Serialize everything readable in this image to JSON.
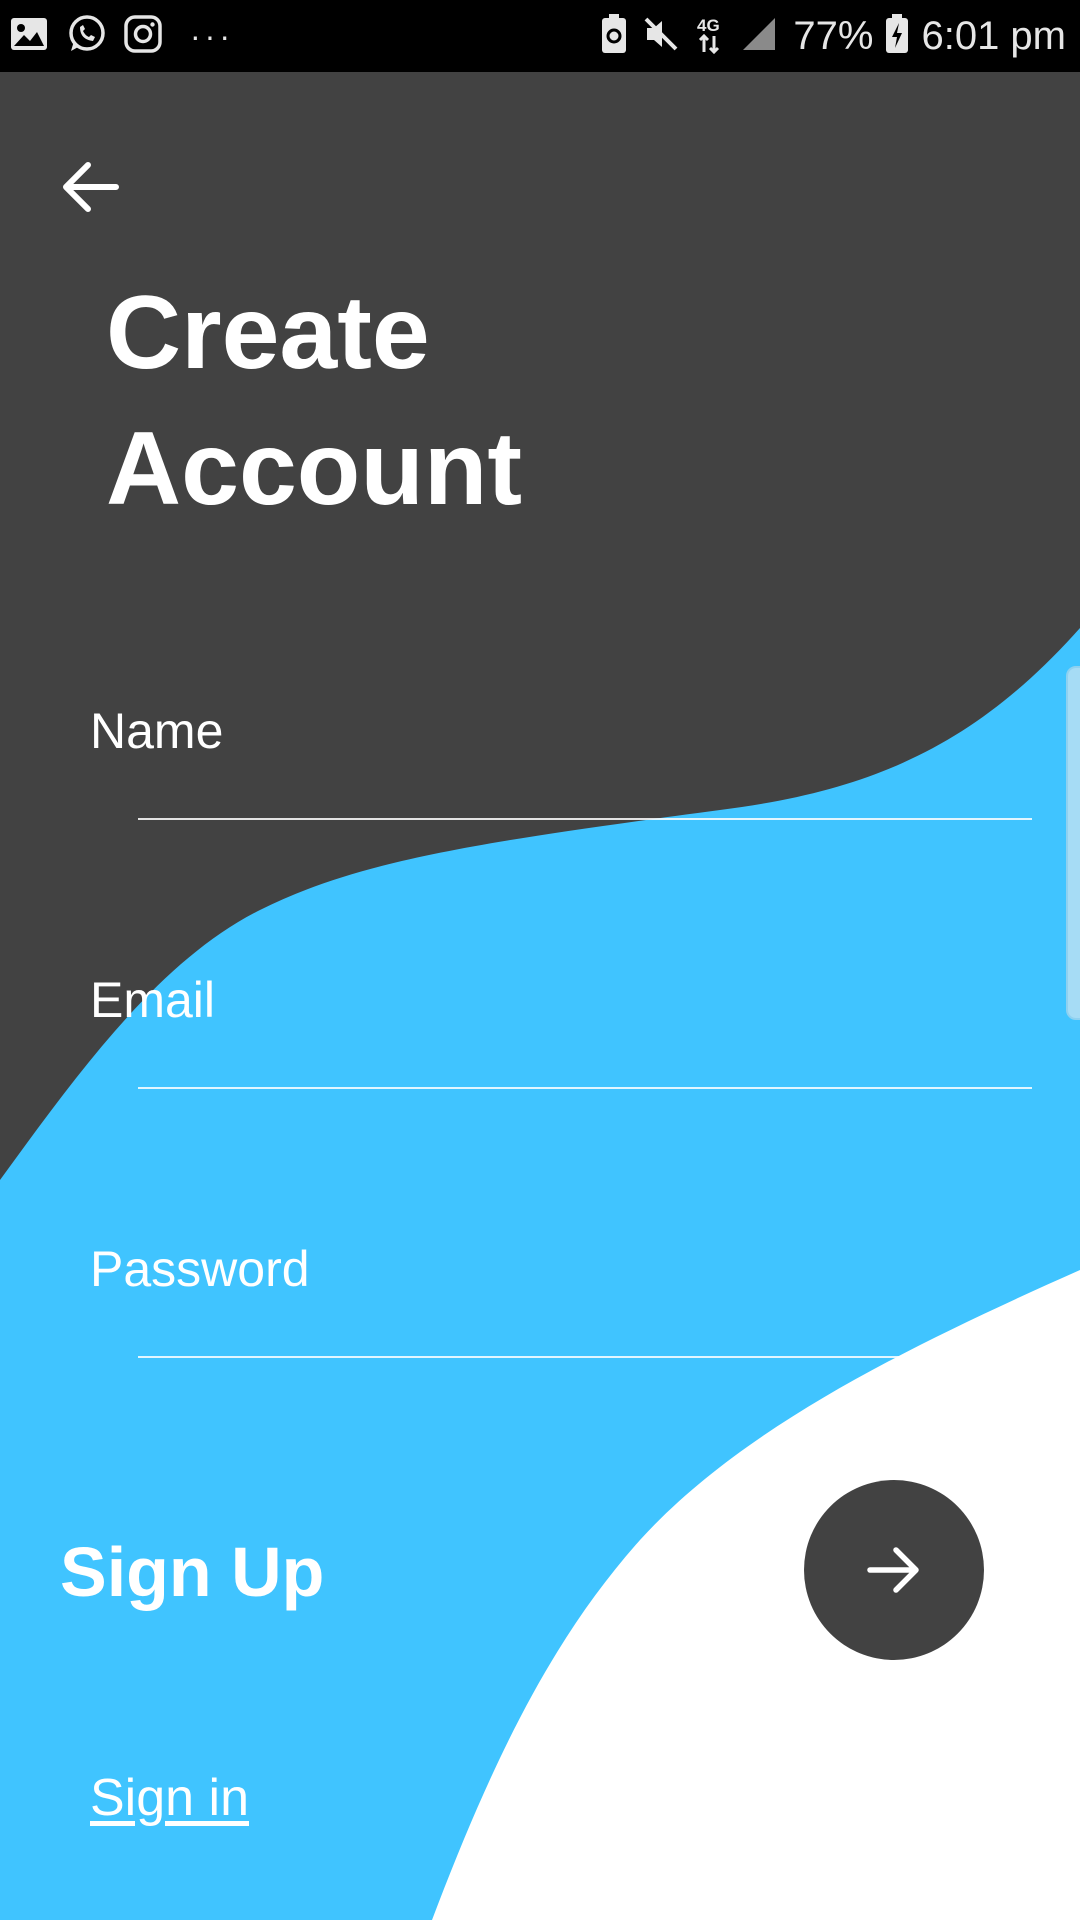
{
  "status_bar": {
    "left_icons": [
      "image-icon",
      "whatsapp-icon",
      "instagram-icon"
    ],
    "overflow": "···",
    "right_icons": [
      "battery-saver-icon",
      "mute-icon",
      "network-4g-icon",
      "signal-icon"
    ],
    "network_type": "4G",
    "battery": "77%",
    "time": "6:01 pm"
  },
  "header": {
    "back_icon": "arrow-left-icon",
    "title_line1": "Create",
    "title_line2": "Account"
  },
  "form": {
    "name_label": "Name",
    "name_value": "",
    "email_label": "Email",
    "email_value": "",
    "password_label": "Password",
    "password_value": ""
  },
  "actions": {
    "signup_label": "Sign Up",
    "submit_icon": "arrow-right-icon",
    "signin_link": "Sign in"
  },
  "colors": {
    "dark": "#424242",
    "accent": "#40c4ff",
    "light": "#ffffff",
    "status_bar": "#000000"
  }
}
